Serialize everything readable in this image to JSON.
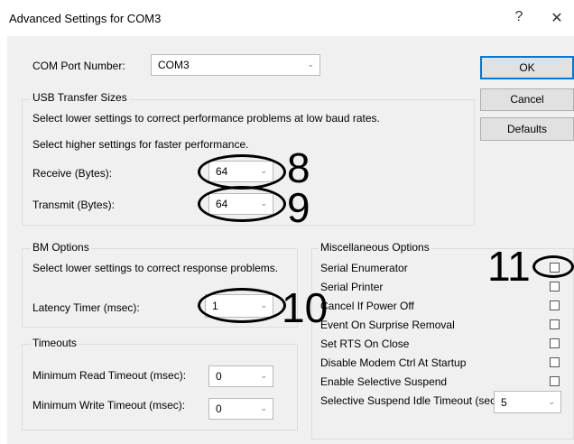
{
  "window": {
    "title": "Advanced Settings for COM3",
    "help_glyph": "?",
    "close_glyph": "✕"
  },
  "com_port": {
    "label": "COM Port Number:",
    "value": "COM3"
  },
  "buttons": {
    "ok": "OK",
    "cancel": "Cancel",
    "defaults": "Defaults"
  },
  "usb": {
    "legend": "USB Transfer Sizes",
    "desc1": "Select lower settings to correct performance problems at low baud rates.",
    "desc2": "Select higher settings for faster performance.",
    "receive_label": "Receive (Bytes):",
    "receive_value": "64",
    "transmit_label": "Transmit (Bytes):",
    "transmit_value": "64"
  },
  "bm": {
    "legend": "BM Options",
    "desc": "Select lower settings to correct response problems.",
    "latency_label": "Latency Timer (msec):",
    "latency_value": "1"
  },
  "timeouts": {
    "legend": "Timeouts",
    "read_label": "Minimum Read Timeout (msec):",
    "read_value": "0",
    "write_label": "Minimum Write Timeout (msec):",
    "write_value": "0"
  },
  "misc": {
    "legend": "Miscellaneous Options",
    "options": [
      {
        "label": "Serial Enumerator",
        "checked": false
      },
      {
        "label": "Serial Printer",
        "checked": false
      },
      {
        "label": "Cancel If Power Off",
        "checked": false
      },
      {
        "label": "Event On Surprise Removal",
        "checked": false
      },
      {
        "label": "Set RTS On Close",
        "checked": false
      },
      {
        "label": "Disable Modem Ctrl At Startup",
        "checked": false
      },
      {
        "label": "Enable Selective Suspend",
        "checked": false
      }
    ],
    "suspend_label": "Selective Suspend Idle Timeout (secs):",
    "suspend_value": "5"
  },
  "annotations": {
    "a8": "8",
    "a9": "9",
    "a10": "10",
    "a11": "11"
  },
  "icons": {
    "combo_arrow": "chevron-down-icon"
  },
  "colors": {
    "accent": "#0078d7",
    "dialog_bg": "#f0f0f0"
  }
}
